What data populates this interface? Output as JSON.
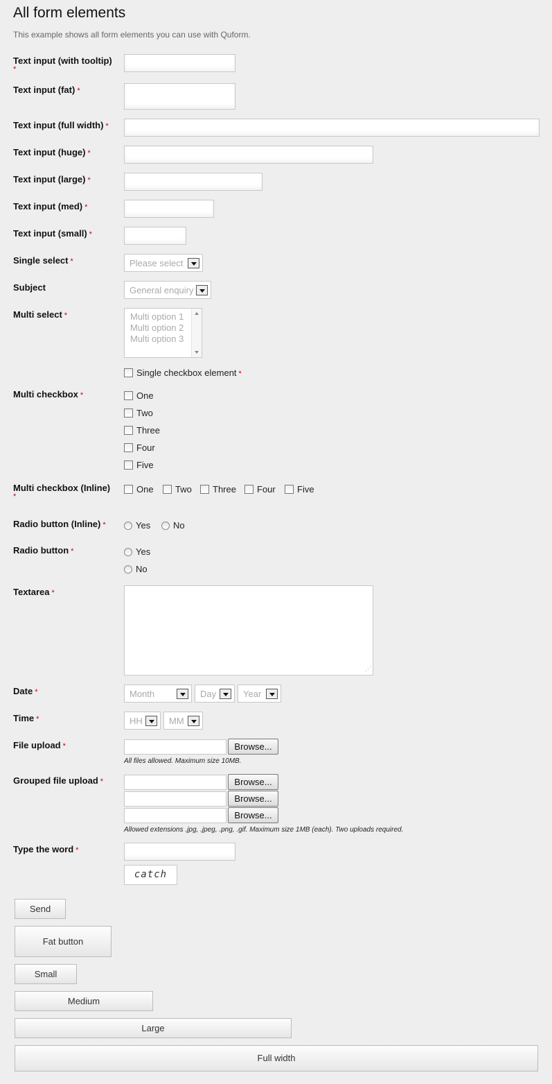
{
  "page": {
    "title": "All form elements",
    "description": "This example shows all form elements you can use with Quform."
  },
  "required_marker": "*",
  "fields": {
    "text_tooltip": "Text input (with tooltip)",
    "text_fat": "Text input (fat)",
    "text_full": "Text input (full width)",
    "text_huge": "Text input (huge)",
    "text_large": "Text input (large)",
    "text_med": "Text input (med)",
    "text_small": "Text input (small)",
    "single_select": "Single select",
    "subject": "Subject",
    "multi_select": "Multi select",
    "multi_checkbox": "Multi checkbox",
    "multi_checkbox_inline": "Multi checkbox (Inline)",
    "radio_inline": "Radio button (Inline)",
    "radio": "Radio button",
    "textarea": "Textarea",
    "date": "Date",
    "time": "Time",
    "file_upload": "File upload",
    "grouped_file_upload": "Grouped file upload",
    "type_word": "Type the word"
  },
  "selects": {
    "single_placeholder": "Please select",
    "subject_value": "General enquiry",
    "date_month": "Month",
    "date_day": "Day",
    "date_year": "Year",
    "time_hh": "HH",
    "time_mm": "MM"
  },
  "multi_select_options": [
    "Multi option 1",
    "Multi option 2",
    "Multi option 3"
  ],
  "single_checkbox_label": "Single checkbox element",
  "checkbox_options": [
    "One",
    "Two",
    "Three",
    "Four",
    "Five"
  ],
  "radio_options": [
    "Yes",
    "No"
  ],
  "browse_label": "Browse...",
  "file_hint": "All files allowed. Maximum size 10MB.",
  "grouped_file_hint": "Allowed extensions .jpg, .jpeg, .png, .gif. Maximum size 1MB (each). Two uploads required.",
  "captcha_word": "catch",
  "buttons": {
    "send": "Send",
    "fat": "Fat button",
    "small": "Small",
    "medium": "Medium",
    "large": "Large",
    "full": "Full width"
  }
}
